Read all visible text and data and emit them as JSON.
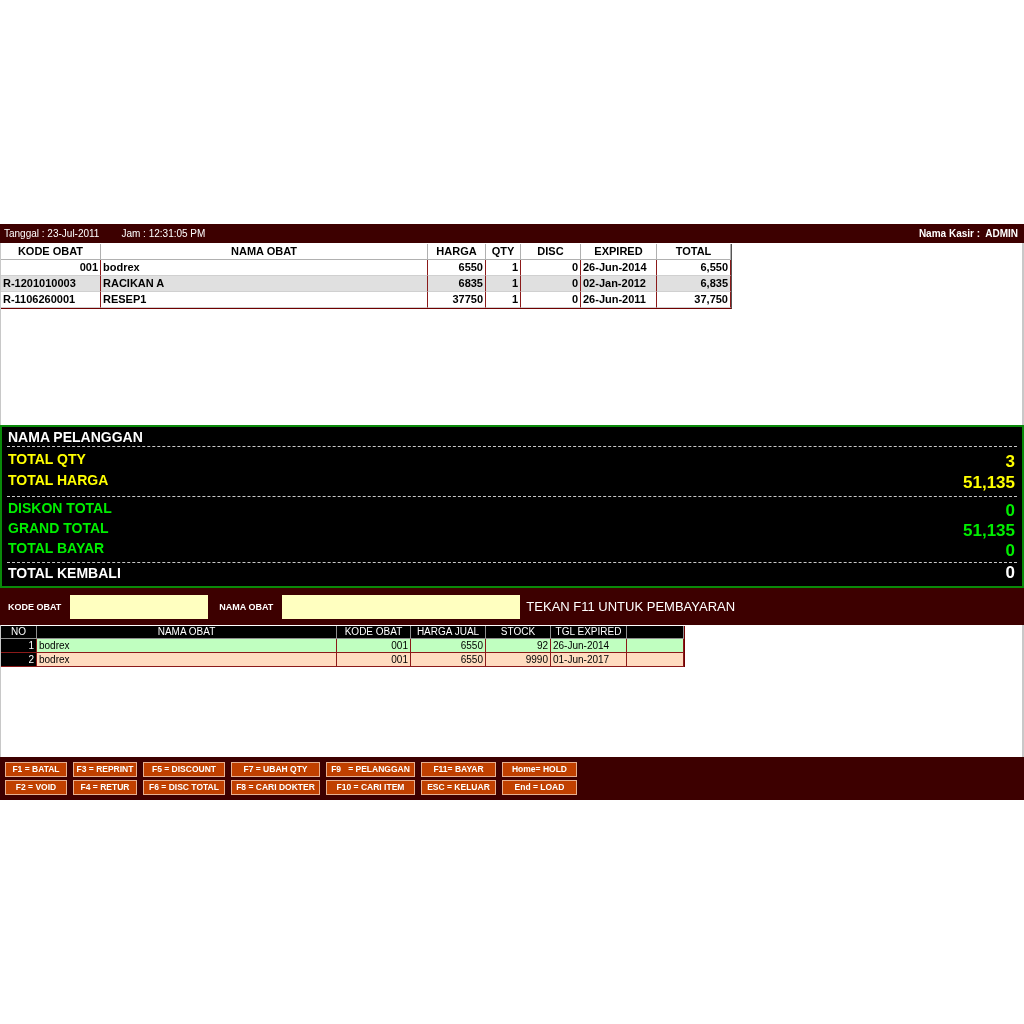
{
  "header": {
    "date": "Tanggal : 23-Jul-2011",
    "time": "Jam : 12:31:05 PM",
    "cashier": "Nama Kasir :  ADMIN"
  },
  "cart_table": {
    "columns": [
      "KODE OBAT",
      "NAMA OBAT",
      "HARGA",
      "QTY",
      "DISC",
      "EXPIRED",
      "TOTAL"
    ],
    "rows": [
      {
        "kind": "item",
        "selected": false,
        "cells": [
          "001",
          "bodrex",
          "6550",
          "1",
          "0",
          "26-Jun-2014",
          "6,550"
        ]
      },
      {
        "kind": "recipe",
        "selected": true,
        "cells": [
          "R-1201010003",
          "RACIKAN A",
          "6835",
          "1",
          "0",
          "02-Jan-2012",
          "6,835"
        ]
      },
      {
        "kind": "recipe",
        "selected": false,
        "cells": [
          "R-1106260001",
          "RESEP1",
          "37750",
          "1",
          "0",
          "26-Jun-2011",
          "37,750"
        ]
      }
    ]
  },
  "summary": {
    "sections": [
      {
        "kind": "customer",
        "lines": [
          {
            "label": "NAMA PELANGGAN"
          }
        ]
      },
      {
        "kind": "subtotal",
        "lines": [
          {
            "label": "TOTAL QTY",
            "value": "3"
          },
          {
            "label": "TOTAL HARGA",
            "value": "51,135"
          }
        ]
      },
      {
        "kind": "payment",
        "lines": [
          {
            "label": "DISKON TOTAL",
            "value": "0"
          },
          {
            "label": "GRAND TOTAL",
            "value": "51,135"
          },
          {
            "label": "TOTAL BAYAR",
            "value": "0"
          }
        ]
      },
      {
        "kind": "change",
        "lines": [
          {
            "label": "TOTAL KEMBALI",
            "value": "0"
          }
        ]
      }
    ]
  },
  "input_bar": {
    "fields": [
      {
        "label": "KODE OBAT"
      },
      {
        "label": "NAMA OBAT"
      }
    ],
    "hint": "TEKAN F11 UNTUK PEMBAYARAN"
  },
  "search_results": {
    "columns": [
      "NO",
      "NAMA OBAT",
      "KODE OBAT",
      "HARGA JUAL",
      "STOCK",
      "TGL EXPIRED"
    ],
    "rows": [
      {
        "color": "#c0ffc0",
        "cells": [
          "1",
          "bodrex",
          "001",
          "6550",
          "92",
          "26-Jun-2014"
        ]
      },
      {
        "color": "#ffdcc0",
        "cells": [
          "2",
          "bodrex",
          "001",
          "6550",
          "9990",
          "01-Jun-2017"
        ]
      }
    ]
  },
  "function_keys": {
    "rows": [
      {
        "keys": [
          "F1 = BATAL",
          "F3 = REPRINT",
          "F5 = DISCOUNT",
          "F7 = UBAH QTY",
          "F9   = PELANGGAN",
          "F11= BAYAR",
          "Home= HOLD"
        ]
      },
      {
        "keys": [
          "F2 = VOID",
          "F4 = RETUR",
          "F6 = DISC TOTAL",
          "F8 = CARI DOKTER",
          "F10 = CARI ITEM",
          "ESC = KELUAR",
          "End = LOAD"
        ]
      }
    ]
  }
}
